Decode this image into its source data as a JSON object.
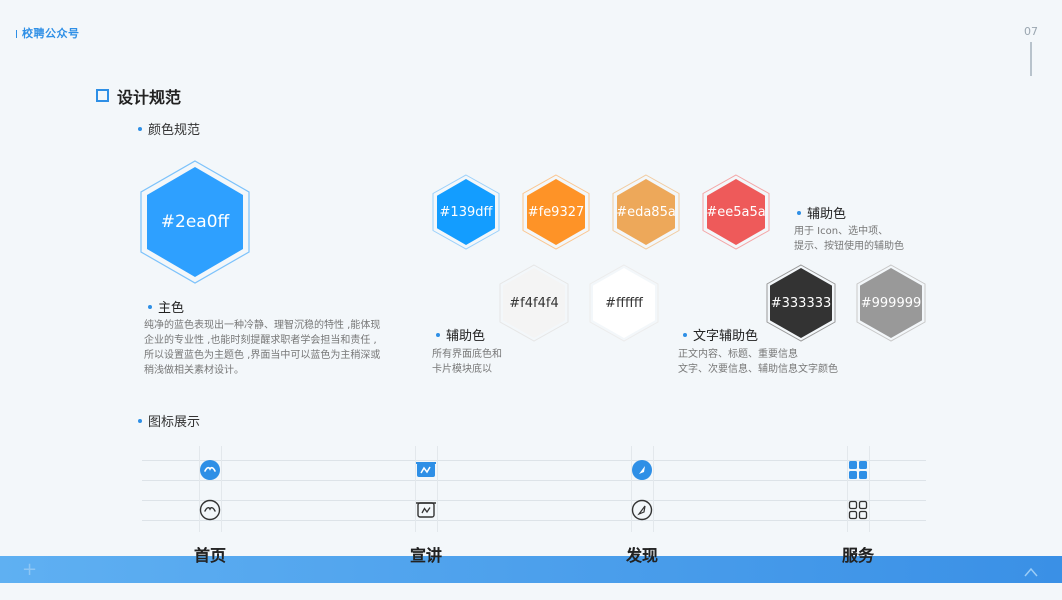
{
  "header": {
    "brand": "校聘公众号",
    "page_number": "07"
  },
  "section": {
    "title": "设计规范"
  },
  "colors": {
    "title": "颜色规范",
    "primary": {
      "code": "#2ea0ff",
      "fill": "#2ea0ff",
      "label": "主色",
      "desc": [
        "纯净的蓝色表现出一种冷静、理智沉稳的特性 ,能体现",
        "企业的专业性 ,也能时刻提醒求职者学会担当和责任 ,",
        "所以设置蓝色为主题色 ,界面当中可以蓝色为主稍深或",
        "稍浅做相关素材设计。"
      ]
    },
    "accent": [
      {
        "code": "#139dff",
        "fill": "#139dff"
      },
      {
        "code": "#fe9327",
        "fill": "#fe9327"
      },
      {
        "code": "#eda85a",
        "fill": "#eda85a"
      },
      {
        "code": "#ee5a5a",
        "fill": "#ee5a5a"
      }
    ],
    "accent_label": "辅助色",
    "accent_desc": [
      "用于 Icon、选中项、",
      "提示、按钮使用的辅助色"
    ],
    "background": [
      {
        "code": "#f4f4f4",
        "fill": "#f4f4f4"
      },
      {
        "code": "#ffffff",
        "fill": "#ffffff"
      }
    ],
    "background_label": "辅助色",
    "background_desc": [
      "所有界面底色和",
      "卡片模块底以"
    ],
    "text": [
      {
        "code": "#333333",
        "fill": "#333333"
      },
      {
        "code": "#999999",
        "fill": "#999999"
      }
    ],
    "text_label": "文字辅助色",
    "text_desc": [
      "正文内容、标题、重要信息",
      "文字、次要信息、辅助信息文字颜色"
    ]
  },
  "icons": {
    "title": "图标展示",
    "nav": [
      {
        "label": "首页",
        "icon": "home-icon"
      },
      {
        "label": "宣讲",
        "icon": "talk-icon"
      },
      {
        "label": "发现",
        "icon": "discover-icon"
      },
      {
        "label": "服务",
        "icon": "service-icon"
      }
    ],
    "active_color": "#2e8fe6",
    "inactive_color": "#333333"
  }
}
